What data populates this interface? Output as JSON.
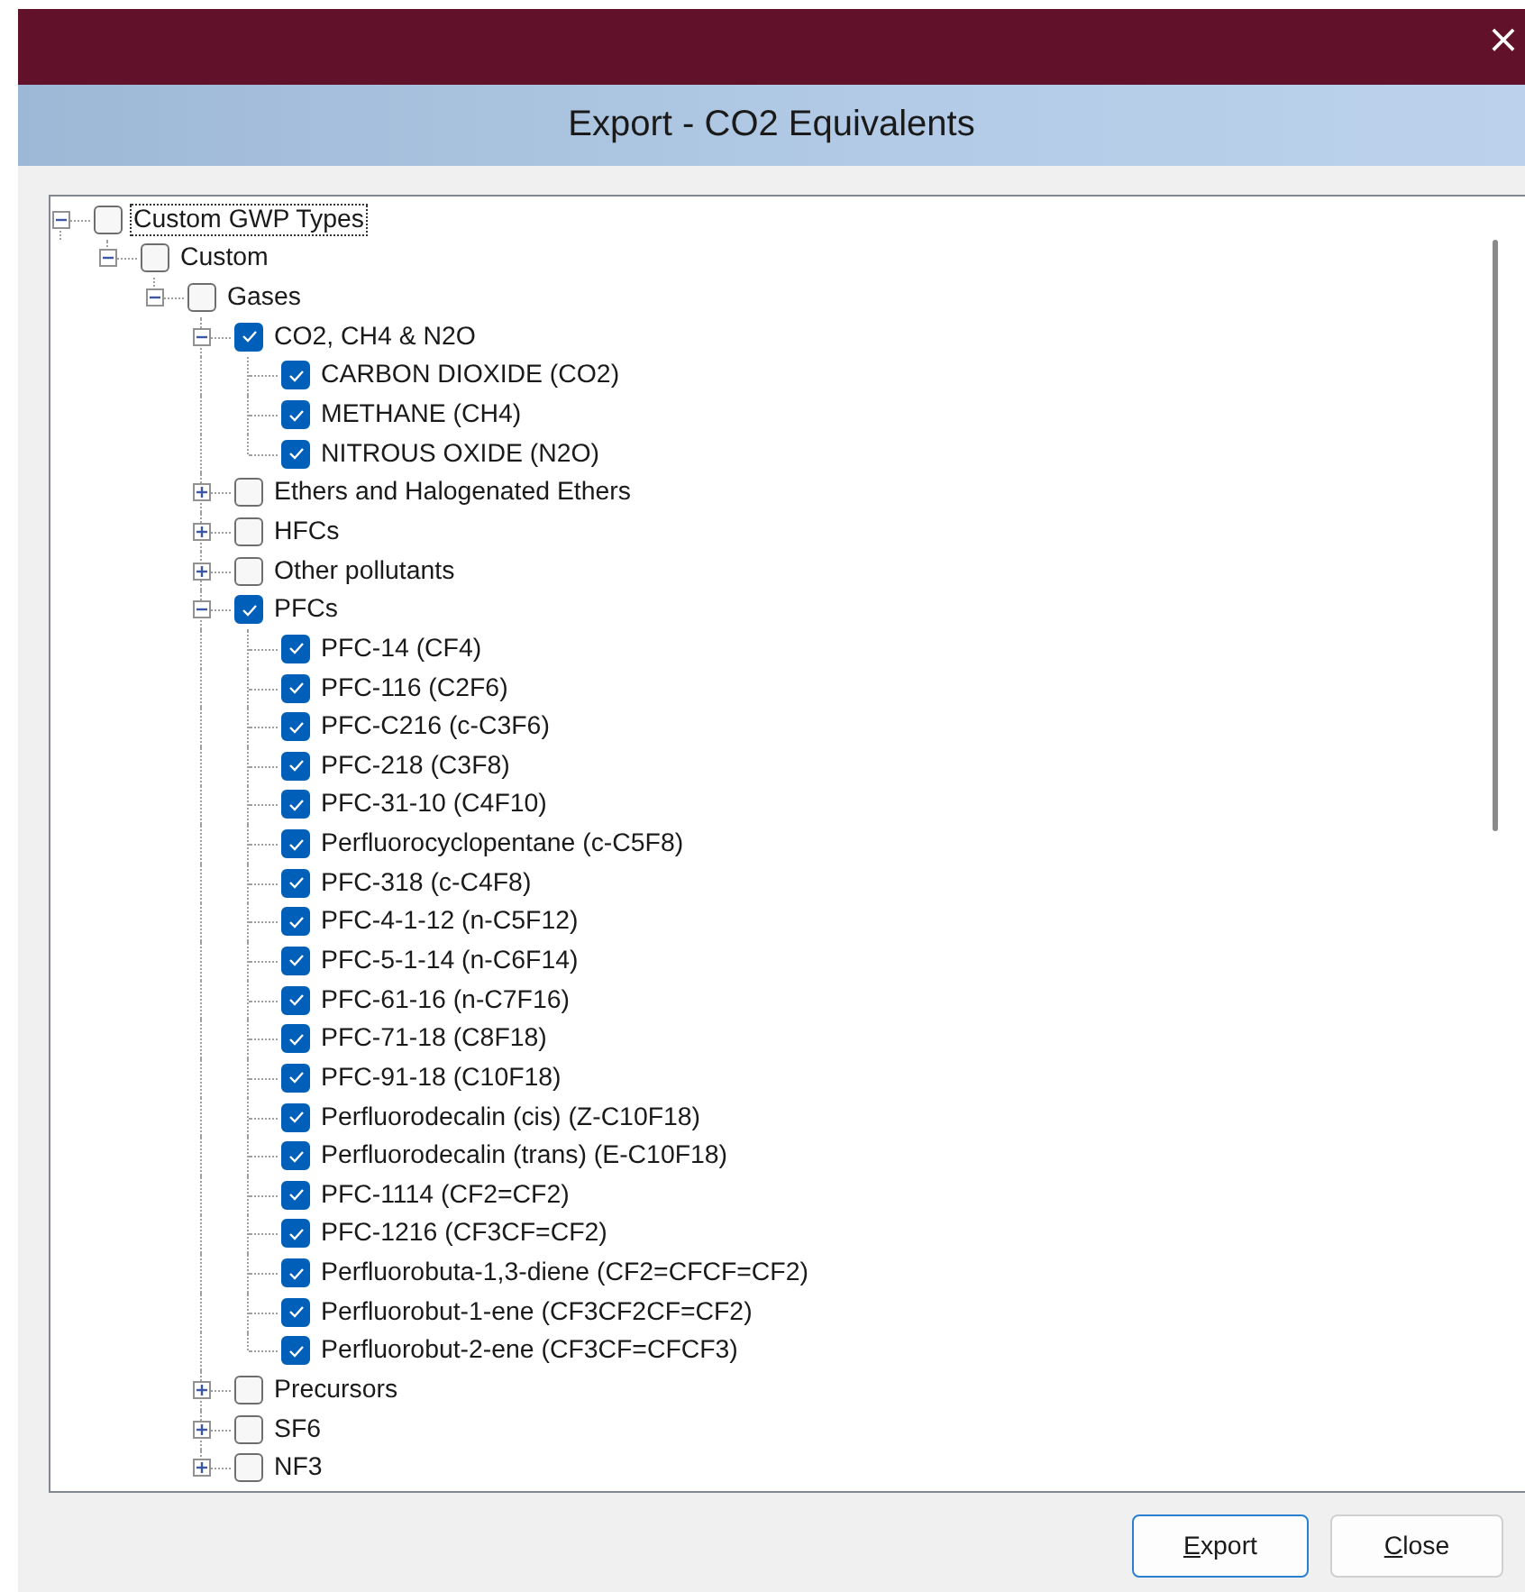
{
  "window": {
    "close_glyph": "×"
  },
  "header": {
    "title": "Export - CO2 Equivalents"
  },
  "tree": [
    {
      "label": "Custom GWP Types",
      "checked": false,
      "expanded": true,
      "focused": true,
      "children": [
        {
          "label": "Custom",
          "checked": false,
          "expanded": true,
          "children": [
            {
              "label": "Gases",
              "checked": false,
              "expanded": true,
              "children": [
                {
                  "label": "CO2, CH4 & N2O",
                  "checked": true,
                  "expanded": true,
                  "children": [
                    {
                      "label": "CARBON DIOXIDE (CO2)",
                      "checked": true
                    },
                    {
                      "label": "METHANE (CH4)",
                      "checked": true
                    },
                    {
                      "label": "NITROUS OXIDE (N2O)",
                      "checked": true
                    }
                  ]
                },
                {
                  "label": "Ethers and Halogenated Ethers",
                  "checked": false,
                  "expanded": false
                },
                {
                  "label": "HFCs",
                  "checked": false,
                  "expanded": false
                },
                {
                  "label": "Other pollutants",
                  "checked": false,
                  "expanded": false
                },
                {
                  "label": "PFCs",
                  "checked": true,
                  "expanded": true,
                  "children": [
                    {
                      "label": "PFC-14 (CF4)",
                      "checked": true
                    },
                    {
                      "label": "PFC-116 (C2F6)",
                      "checked": true
                    },
                    {
                      "label": "PFC-C216 (c-C3F6)",
                      "checked": true
                    },
                    {
                      "label": "PFC-218 (C3F8)",
                      "checked": true
                    },
                    {
                      "label": "PFC-31-10 (C4F10)",
                      "checked": true
                    },
                    {
                      "label": "Perfluorocyclopentane (c-C5F8)",
                      "checked": true
                    },
                    {
                      "label": "PFC-318 (c-C4F8)",
                      "checked": true
                    },
                    {
                      "label": "PFC-4-1-12 (n-C5F12)",
                      "checked": true
                    },
                    {
                      "label": "PFC-5-1-14 (n-C6F14)",
                      "checked": true
                    },
                    {
                      "label": "PFC-61-16 (n-C7F16)",
                      "checked": true
                    },
                    {
                      "label": "PFC-71-18 (C8F18)",
                      "checked": true
                    },
                    {
                      "label": "PFC-91-18 (C10F18)",
                      "checked": true
                    },
                    {
                      "label": "Perfluorodecalin (cis) (Z-C10F18)",
                      "checked": true
                    },
                    {
                      "label": "Perfluorodecalin (trans) (E-C10F18)",
                      "checked": true
                    },
                    {
                      "label": "PFC-1114 (CF2=CF2)",
                      "checked": true
                    },
                    {
                      "label": "PFC-1216 (CF3CF=CF2)",
                      "checked": true
                    },
                    {
                      "label": "Perfluorobuta-1,3-diene (CF2=CFCF=CF2)",
                      "checked": true
                    },
                    {
                      "label": "Perfluorobut-1-ene (CF3CF2CF=CF2)",
                      "checked": true
                    },
                    {
                      "label": "Perfluorobut-2-ene (CF3CF=CFCF3)",
                      "checked": true
                    }
                  ]
                },
                {
                  "label": "Precursors",
                  "checked": false,
                  "expanded": false
                },
                {
                  "label": "SF6",
                  "checked": false,
                  "expanded": false
                },
                {
                  "label": "NF3",
                  "checked": false,
                  "expanded": false
                }
              ]
            }
          ]
        }
      ]
    }
  ],
  "buttons": [
    {
      "label": "Export",
      "default": true
    },
    {
      "label": "Close",
      "default": false
    }
  ]
}
